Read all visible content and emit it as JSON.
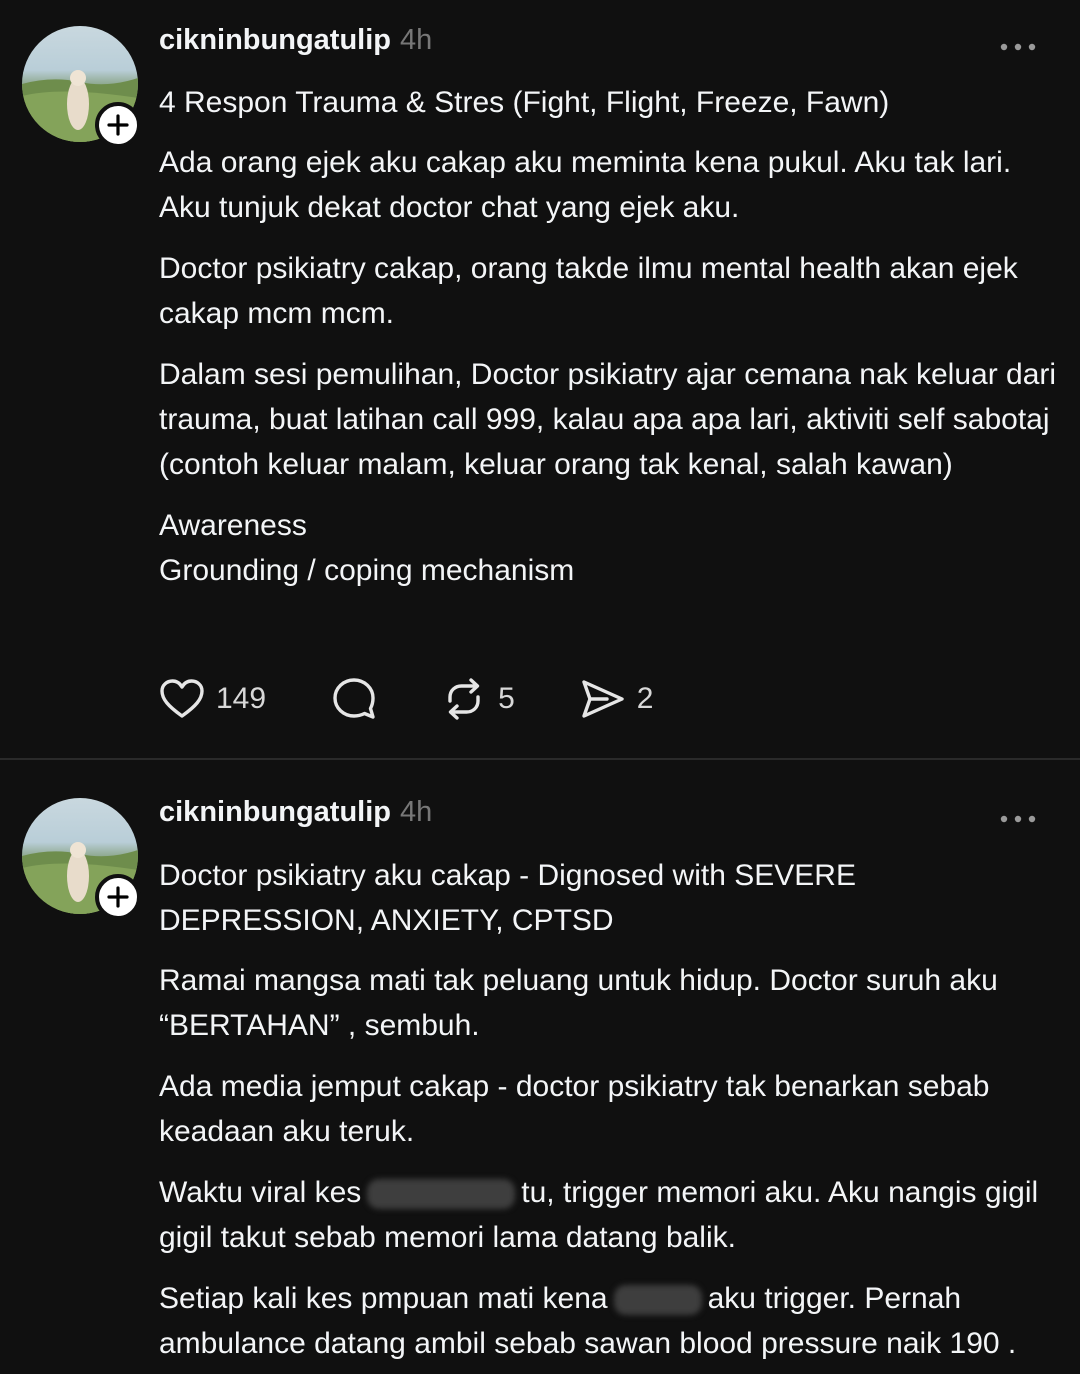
{
  "posts": [
    {
      "username": "cikninbungatulip",
      "time": "4h",
      "paragraphs": [
        "4 Respon Trauma & Stres (Fight, Flight, Freeze, Fawn)",
        "Ada orang ejek aku cakap aku meminta kena pukul. Aku tak lari. Aku tunjuk dekat doctor chat yang ejek aku.",
        "Doctor psikiatry cakap, orang takde ilmu mental health akan ejek cakap mcm mcm.",
        "Dalam sesi pemulihan, Doctor psikiatry ajar cemana nak keluar dari trauma, buat latihan call 999, kalau apa apa lari, aktiviti self sabotaj (contoh keluar malam, keluar orang tak kenal, salah kawan)",
        "Awareness",
        "Grounding / coping mechanism"
      ],
      "likes": "149",
      "reposts": "5",
      "shares": "2"
    },
    {
      "username": "cikninbungatulip",
      "time": "4h",
      "paragraphs": [
        "Doctor psikiatry aku cakap - Dignosed with SEVERE DEPRESSION, ANXIETY, CPTSD",
        "Ramai mangsa mati tak peluang untuk hidup. Doctor suruh aku “BERTAHAN” , sembuh.",
        "Ada media jemput cakap - doctor psikiatry tak benarkan sebab keadaan aku teruk."
      ],
      "viral_before": "Waktu viral kes",
      "viral_after": "tu, trigger memori aku. Aku nangis gigil gigil takut sebab memori lama datang balik.",
      "setiap_before": "Setiap kali kes pmpuan mati kena",
      "setiap_after": "aku trigger. Pernah ambulance datang ambil sebab sawan blood pressure naik 190 ."
    }
  ],
  "icons": {
    "follow": "plus-icon",
    "more": "more-horizontal-icon",
    "like": "heart-icon",
    "comment": "comment-bubble-icon",
    "repost": "repost-icon",
    "share": "send-icon"
  },
  "colors": {
    "background": "#101010",
    "text": "#f3f5f7",
    "muted": "#777777",
    "divider": "#2a2a2a"
  }
}
